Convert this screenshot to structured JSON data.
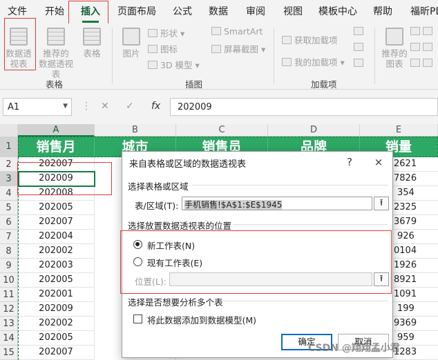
{
  "tabs": [
    "文件",
    "开始",
    "插入",
    "页面布局",
    "公式",
    "数据",
    "审阅",
    "视图",
    "模板中心",
    "帮助",
    "福昕PD"
  ],
  "ribbon": {
    "pivot_table": [
      "数据透",
      "视表"
    ],
    "recommended_pivot": [
      "推荐的",
      "数据透视表"
    ],
    "table": "表格",
    "pictures": "图片",
    "shapes": "形状",
    "icons": "图标",
    "models_3d": "3D 模型",
    "smartart": "SmartArt",
    "screenshot": "屏幕截图",
    "get_addins": "获取加载项",
    "my_addins": "我的加载项",
    "recommended_charts": [
      "推荐的",
      "图表"
    ],
    "groups": {
      "tables": "表格",
      "illustrations": "插图",
      "addins": "加载项"
    }
  },
  "formula_bar": {
    "name_box": "A1",
    "fx": "fx",
    "value": "202009"
  },
  "grid": {
    "columns": [
      "A",
      "B",
      "C",
      "D",
      "E"
    ],
    "headers": [
      "销售月",
      "城市",
      "销售员",
      "品牌",
      "销量"
    ],
    "rows": [
      {
        "n": "1"
      },
      {
        "n": "2",
        "a": "202007",
        "e": "2621"
      },
      {
        "n": "3",
        "a": "202009",
        "e": "7826"
      },
      {
        "n": "4",
        "a": "202008",
        "e": "354"
      },
      {
        "n": "5",
        "a": "202005",
        "e": "2325"
      },
      {
        "n": "6",
        "a": "202007",
        "e": "3679"
      },
      {
        "n": "7",
        "a": "202004",
        "e": "926"
      },
      {
        "n": "8",
        "a": "202002",
        "e": "0104"
      },
      {
        "n": "9",
        "a": "202003",
        "e": "1926"
      },
      {
        "n": "10",
        "a": "202005",
        "e": "8921"
      },
      {
        "n": "11",
        "a": "202001",
        "e": "1091"
      },
      {
        "n": "12",
        "a": "202009",
        "e": "199"
      },
      {
        "n": "13",
        "a": "202002",
        "e": "9369"
      },
      {
        "n": "14",
        "a": "202005",
        "e": "959"
      },
      {
        "n": "15",
        "a": "202007",
        "e": "1283"
      }
    ]
  },
  "dialog": {
    "title": "来自表格或区域的数据透视表",
    "help": "?",
    "close": "×",
    "section1": "选择表格或区域",
    "range_label": "表/区域(T):",
    "range_value": "手机销售!$A$1:$E$1945",
    "section2": "选择放置数据透视表的位置",
    "opt_new": "新工作表(N)",
    "opt_existing": "现有工作表(E)",
    "location_label": "位置(L):",
    "location_value": "",
    "section3": "选择是否想要分析多个表",
    "add_model": "将此数据添加到数据模型(M)",
    "ok": "确定",
    "cancel": "取消"
  },
  "watermark": "CSDN @翔翔孟小君",
  "colors": {
    "accent": "#107c41",
    "header_fill": "#2ea865",
    "highlight": "#e03a3a"
  }
}
